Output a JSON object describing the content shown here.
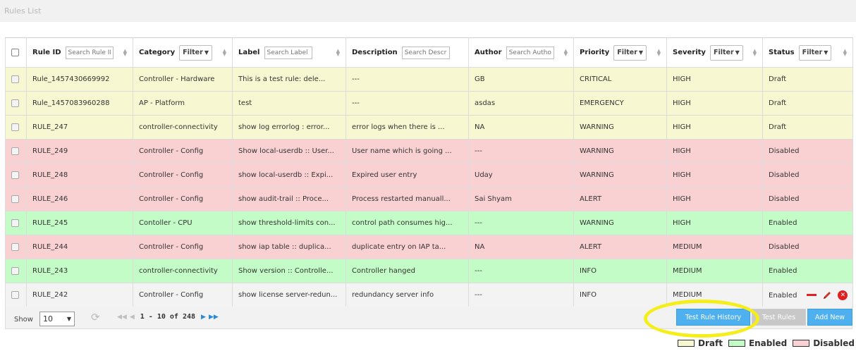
{
  "page": {
    "title": "Rules List"
  },
  "columns": {
    "rule_id": {
      "label": "Rule ID",
      "placeholder": "Search Rule ID"
    },
    "category": {
      "label": "Category",
      "filter": "Filter"
    },
    "label": {
      "label": "Label",
      "placeholder": "Search Label"
    },
    "description": {
      "label": "Description",
      "placeholder": "Search Description"
    },
    "author": {
      "label": "Author",
      "placeholder": "Search Author"
    },
    "priority": {
      "label": "Priority",
      "filter": "Filter"
    },
    "severity": {
      "label": "Severity",
      "filter": "Filter"
    },
    "status": {
      "label": "Status",
      "filter": "Filter"
    }
  },
  "rows": [
    {
      "id": "Rule_1457430669992",
      "category": "Controller - Hardware",
      "label": "This is a test rule: dele...",
      "description": "---",
      "author": "GB",
      "priority": "CRITICAL",
      "severity": "HIGH",
      "status": "Draft"
    },
    {
      "id": "Rule_1457083960288",
      "category": "AP - Platform",
      "label": "test",
      "description": "---",
      "author": "asdas",
      "priority": "EMERGENCY",
      "severity": "HIGH",
      "status": "Draft"
    },
    {
      "id": "RULE_247",
      "category": "controller-connectivity",
      "label": "show log errorlog : error...",
      "description": "error logs when there is ...",
      "author": "NA",
      "priority": "WARNING",
      "severity": "HIGH",
      "status": "Draft"
    },
    {
      "id": "RULE_249",
      "category": "Controller - Config",
      "label": "Show local-userdb :: User...",
      "description": "User name which is going ...",
      "author": "---",
      "priority": "WARNING",
      "severity": "HIGH",
      "status": "Disabled"
    },
    {
      "id": "RULE_248",
      "category": "Controller - Config",
      "label": "show local-userdb :: Expi...",
      "description": "Expired user entry",
      "author": "Uday",
      "priority": "WARNING",
      "severity": "HIGH",
      "status": "Disabled"
    },
    {
      "id": "RULE_246",
      "category": "Controller - Config",
      "label": "show audit-trail :: Proce...",
      "description": "Process restarted manuall...",
      "author": "Sai Shyam",
      "priority": "ALERT",
      "severity": "HIGH",
      "status": "Disabled"
    },
    {
      "id": "RULE_245",
      "category": "Contoller - CPU",
      "label": "show threshold-limits con...",
      "description": "control path consumes hig...",
      "author": "---",
      "priority": "WARNING",
      "severity": "HIGH",
      "status": "Enabled"
    },
    {
      "id": "RULE_244",
      "category": "Controller - Config",
      "label": "show iap table :: duplica...",
      "description": "duplicate entry on IAP ta...",
      "author": "NA",
      "priority": "ALERT",
      "severity": "MEDIUM",
      "status": "Disabled"
    },
    {
      "id": "RULE_243",
      "category": "controller-connectivity",
      "label": "Show version :: Controlle...",
      "description": "Controller hanged",
      "author": "---",
      "priority": "INFO",
      "severity": "MEDIUM",
      "status": "Enabled"
    },
    {
      "id": "RULE_242",
      "category": "Controller - Config",
      "label": "show license server-redun...",
      "description": "redundancy server info",
      "author": "---",
      "priority": "INFO",
      "severity": "MEDIUM",
      "status": "Enabled"
    }
  ],
  "footer": {
    "show_label": "Show",
    "page_size": "10",
    "page_info": "1 - 10 of 248",
    "buttons": {
      "history": "Test Rule History",
      "test": "Test Rules",
      "add": "Add New"
    }
  },
  "legend": [
    {
      "label": "Draft",
      "color": "#f7f8d1"
    },
    {
      "label": "Enabled",
      "color": "#c3fcc6"
    },
    {
      "label": "Disabled",
      "color": "#fad1d3"
    }
  ],
  "colors": {
    "draft": "#f7f8d1",
    "enabled": "#c3fcc6",
    "disabled": "#fad1d3",
    "accent": "#4eb0ee",
    "highlight": "#f5ee1a",
    "danger": "#e02020"
  }
}
